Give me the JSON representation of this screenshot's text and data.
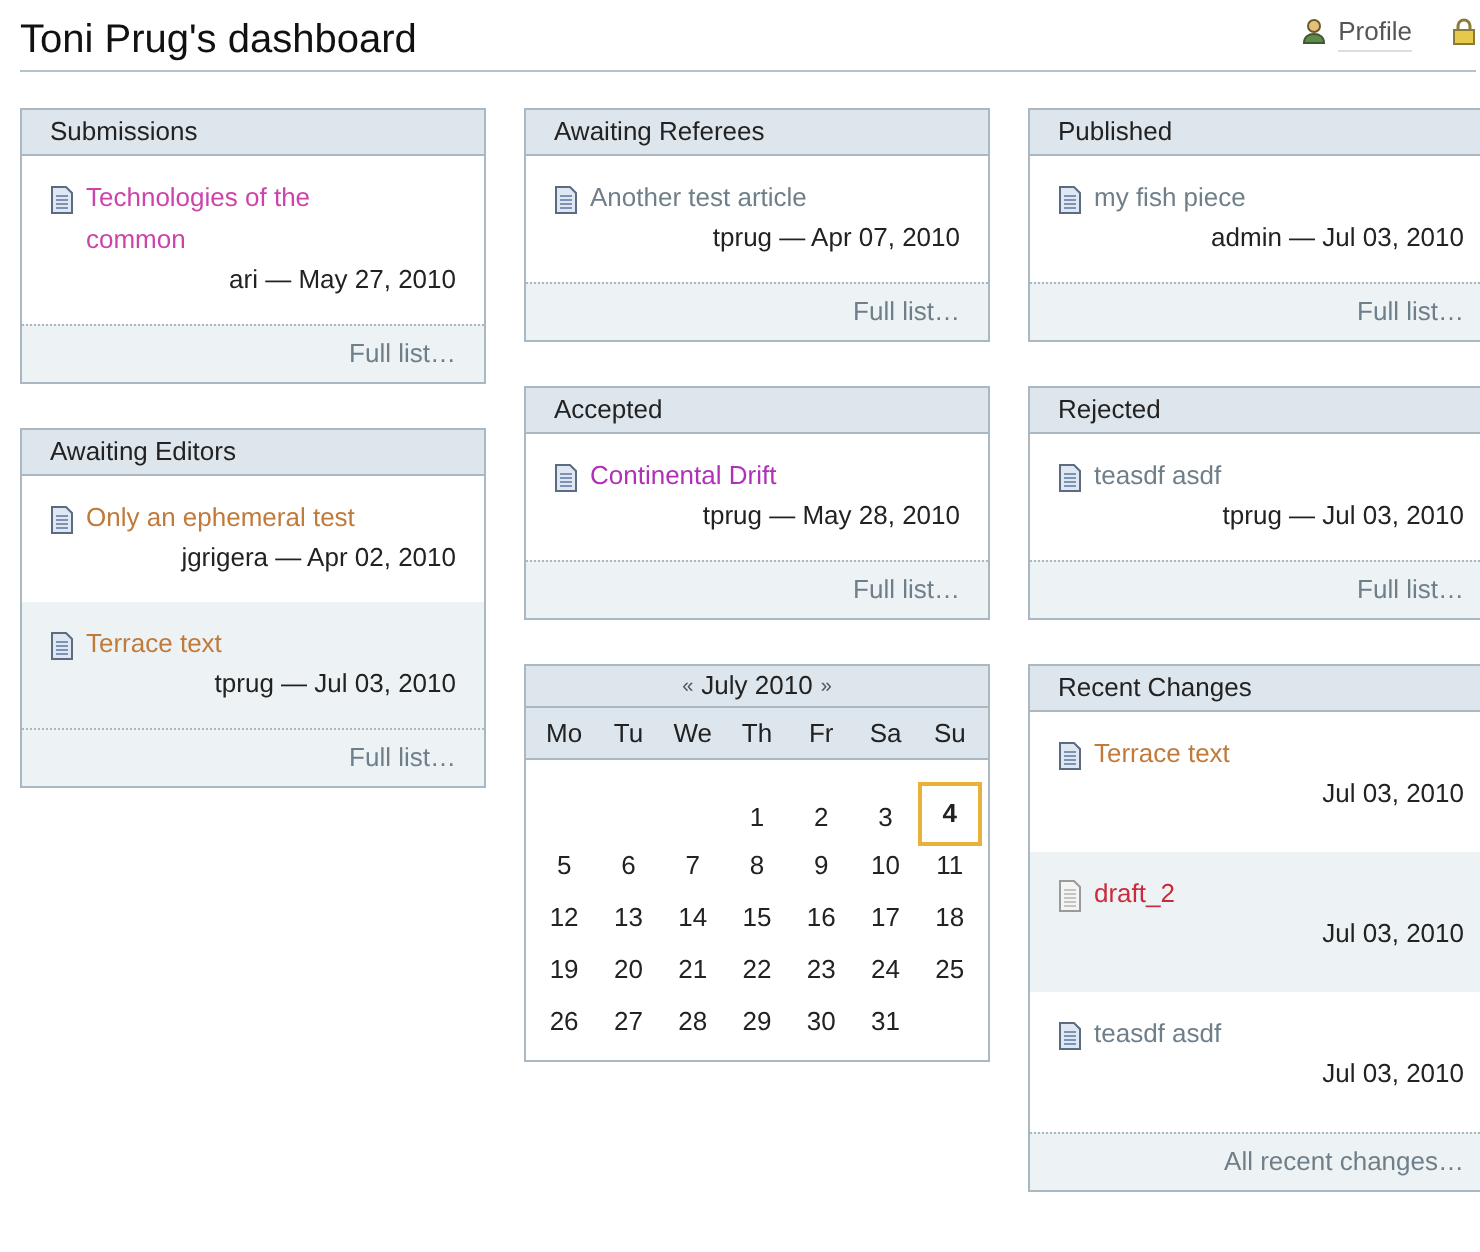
{
  "page": {
    "title": "Toni Prug's dashboard",
    "profile_link": "Profile"
  },
  "columns": [
    {
      "panels": [
        {
          "kind": "list",
          "title": "Submissions",
          "items": [
            {
              "kind": "document",
              "title": "Technologies of the common",
              "color": "#cc44aa",
              "meta": "ari — May 27, 2010"
            }
          ],
          "footer": "Full list…"
        },
        {
          "kind": "list",
          "title": "Awaiting Editors",
          "items": [
            {
              "kind": "document",
              "title": "Only an ephemeral test",
              "color": "#c07a3a",
              "meta": "jgrigera — Apr 02, 2010"
            },
            {
              "kind": "document",
              "title": "Terrace text",
              "color": "#c07a3a",
              "meta": "tprug — Jul 03, 2010"
            }
          ],
          "footer": "Full list…"
        }
      ]
    },
    {
      "panels": [
        {
          "kind": "list",
          "title": "Awaiting Referees",
          "items": [
            {
              "kind": "document",
              "title": "Another test article",
              "color": "#6f7f8a",
              "meta": "tprug — Apr 07, 2010"
            }
          ],
          "footer": "Full list…"
        },
        {
          "kind": "list",
          "title": "Accepted",
          "items": [
            {
              "kind": "document",
              "title": "Continental Drift",
              "color": "#b030b8",
              "meta": "tprug — May 28, 2010"
            }
          ],
          "footer": "Full list…"
        },
        {
          "kind": "calendar",
          "prev": "«",
          "month": "July 2010",
          "next": "»",
          "weekdays": [
            "Mo",
            "Tu",
            "We",
            "Th",
            "Fr",
            "Sa",
            "Su"
          ],
          "weeks": [
            [
              {
                "kind": "blank"
              },
              {
                "kind": "blank"
              },
              {
                "kind": "blank"
              },
              {
                "kind": "day",
                "label": "1",
                "selected": false
              },
              {
                "kind": "day",
                "label": "2",
                "selected": false
              },
              {
                "kind": "day",
                "label": "3",
                "selected": false
              },
              {
                "kind": "day",
                "label": "4",
                "selected": true
              }
            ],
            [
              {
                "kind": "day",
                "label": "5",
                "selected": false
              },
              {
                "kind": "day",
                "label": "6",
                "selected": false
              },
              {
                "kind": "day",
                "label": "7",
                "selected": false
              },
              {
                "kind": "day",
                "label": "8",
                "selected": false
              },
              {
                "kind": "day",
                "label": "9",
                "selected": false
              },
              {
                "kind": "day",
                "label": "10",
                "selected": false
              },
              {
                "kind": "day",
                "label": "11",
                "selected": false
              }
            ],
            [
              {
                "kind": "day",
                "label": "12",
                "selected": false
              },
              {
                "kind": "day",
                "label": "13",
                "selected": false
              },
              {
                "kind": "day",
                "label": "14",
                "selected": false
              },
              {
                "kind": "day",
                "label": "15",
                "selected": false
              },
              {
                "kind": "day",
                "label": "16",
                "selected": false
              },
              {
                "kind": "day",
                "label": "17",
                "selected": false
              },
              {
                "kind": "day",
                "label": "18",
                "selected": false
              }
            ],
            [
              {
                "kind": "day",
                "label": "19",
                "selected": false
              },
              {
                "kind": "day",
                "label": "20",
                "selected": false
              },
              {
                "kind": "day",
                "label": "21",
                "selected": false
              },
              {
                "kind": "day",
                "label": "22",
                "selected": false
              },
              {
                "kind": "day",
                "label": "23",
                "selected": false
              },
              {
                "kind": "day",
                "label": "24",
                "selected": false
              },
              {
                "kind": "day",
                "label": "25",
                "selected": false
              }
            ],
            [
              {
                "kind": "day",
                "label": "26",
                "selected": false
              },
              {
                "kind": "day",
                "label": "27",
                "selected": false
              },
              {
                "kind": "day",
                "label": "28",
                "selected": false
              },
              {
                "kind": "day",
                "label": "29",
                "selected": false
              },
              {
                "kind": "day",
                "label": "30",
                "selected": false
              },
              {
                "kind": "day",
                "label": "31",
                "selected": false
              },
              {
                "kind": "blank"
              }
            ]
          ]
        }
      ]
    },
    {
      "panels": [
        {
          "kind": "list",
          "title": "Published",
          "items": [
            {
              "kind": "document",
              "title": "my fish piece",
              "color": "#6f7f8a",
              "meta": "admin — Jul 03, 2010"
            }
          ],
          "footer": "Full list…"
        },
        {
          "kind": "list",
          "title": "Rejected",
          "items": [
            {
              "kind": "document",
              "title": "teasdf asdf",
              "color": "#6f7f8a",
              "meta": "tprug — Jul 03, 2010"
            }
          ],
          "footer": "Full list…"
        },
        {
          "kind": "recent",
          "title": "Recent Changes",
          "items": [
            {
              "kind": "document",
              "title": "Terrace text",
              "color": "#c07a3a",
              "meta": "Jul 03, 2010"
            },
            {
              "kind": "page",
              "title": "draft_2",
              "color": "#cc2a3a",
              "meta": "Jul 03, 2010"
            },
            {
              "kind": "document",
              "title": "teasdf asdf",
              "color": "#6f7f8a",
              "meta": "Jul 03, 2010"
            }
          ],
          "footer": "All recent changes…"
        }
      ]
    }
  ]
}
